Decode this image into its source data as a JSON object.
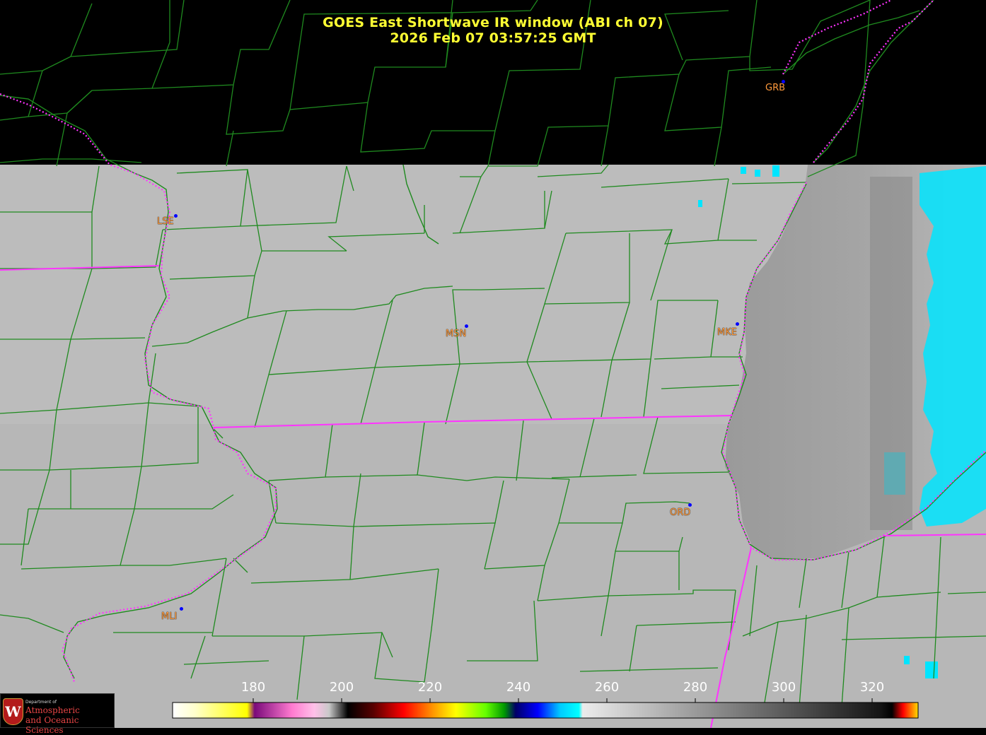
{
  "title": {
    "line1": "GOES East Shortwave IR window (ABI ch 07)",
    "line2": "2026 Feb 07  03:57:25 GMT"
  },
  "colors": {
    "title": "#ffff33",
    "county_lines": "#1f8a1f",
    "state_lines": "#ff33ff",
    "station_labels": "#ff9a3c",
    "station_dots": "#0000ff",
    "cloud_cold": "#00e5ff",
    "no_data": "#000000"
  },
  "stations": [
    {
      "id": "GRB"
    },
    {
      "id": "LSE"
    },
    {
      "id": "MSN"
    },
    {
      "id": "MKE"
    },
    {
      "id": "ORD"
    },
    {
      "id": "MLI"
    }
  ],
  "colorbar": {
    "ticks": [
      "180",
      "200",
      "220",
      "240",
      "260",
      "280",
      "300",
      "320"
    ]
  },
  "logo": {
    "dept": "Department of",
    "line1": "Atmospheric",
    "line2": "and Oceanic Sciences",
    "letter": "W"
  }
}
